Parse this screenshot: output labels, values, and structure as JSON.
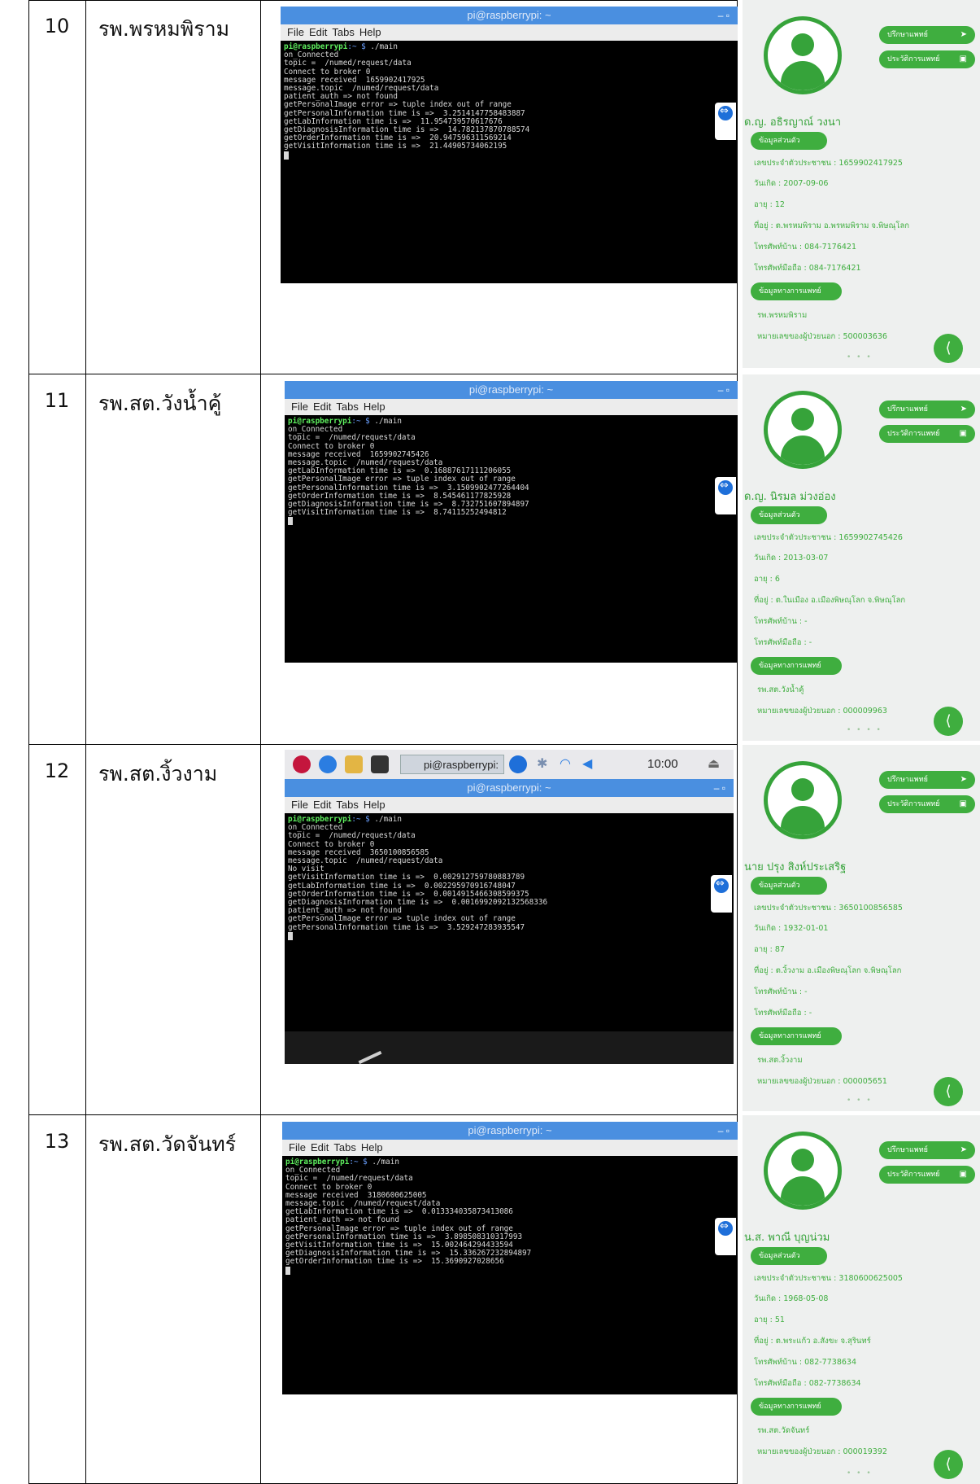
{
  "rows": [
    {
      "number": "10",
      "hospital": "รพ.พรหมพิราม",
      "terminal": {
        "title": "pi@raspberrypi: ~",
        "menu": [
          "File",
          "Edit",
          "Tabs",
          "Help"
        ],
        "prompt_user": "pi@raspberrypi",
        "prompt_path": ":~ $",
        "command": " ./main",
        "lines": [
          "on_Connected",
          "topic =  /numed/request/data",
          "Connect to broker 0",
          "message received  1659902417925",
          "message.topic  /numed/request/data",
          "patient_auth => not found",
          "getPersonalImage error => tuple index out of range",
          "getPersonalInformation time is =>  3.2514147758483887",
          "getLabInformation time is =>  11.954739570617676",
          "getDiagnosisInformation time is =>  14.782137870788574",
          "getOrderInformation time is =>  20.947596311569214",
          "getVisitInformation time is =>  21.44905734062195"
        ]
      },
      "profile": {
        "btn_consult": "ปรึกษาแพทย์",
        "btn_history": "ประวัติการแพทย์",
        "name": "ด.ญ. อธิรญาณ์ วงนา",
        "sec_personal": "ข้อมูลส่วนตัว",
        "id_line": "เลขประจำตัวประชาชน : 1659902417925",
        "birth_line": "วันเกิด : 2007-09-06",
        "age_line": "อายุ : 12",
        "addr_line": "ที่อยู่ : ต.พรหมพิราม อ.พรหมพิราม จ.พิษณุโลก",
        "phone_line": "โทรศัพท์บ้าน : 084-7176421",
        "mobile_line": "โทรศัพท์มือถือ : 084-7176421",
        "sec_medical": "ข้อมูลทางการแพทย์",
        "hospital_line": "รพ.พรหมพิราม",
        "hn_line": "หมายเลขของผู้ป่วยนอก : 500003636",
        "pager": "• • •"
      }
    },
    {
      "number": "11",
      "hospital": "รพ.สต.วังน้ำคู้",
      "terminal": {
        "title": "pi@raspberrypi: ~",
        "menu": [
          "File",
          "Edit",
          "Tabs",
          "Help"
        ],
        "prompt_user": "pi@raspberrypi",
        "prompt_path": ":~ $",
        "command": " ./main",
        "lines": [
          "on_Connected",
          "topic =  /numed/request/data",
          "Connect to broker 0",
          "message received  1659902745426",
          "message.topic  /numed/request/data",
          "getLabInformation time is =>  0.16887617111206055",
          "getPersonalImage error => tuple index out of range",
          "getPersonalInformation time is =>  3.1509902477264404",
          "getOrderInformation time is =>  8.545461177825928",
          "getDiagnosisInformation time is =>  8.732751607894897",
          "getVisitInformation time is =>  8.74115252494812"
        ]
      },
      "profile": {
        "btn_consult": "ปรึกษาแพทย์",
        "btn_history": "ประวัติการแพทย์",
        "name": "ด.ญ. นิรมล ม่วงอ่อง",
        "sec_personal": "ข้อมูลส่วนตัว",
        "id_line": "เลขประจำตัวประชาชน : 1659902745426",
        "birth_line": "วันเกิด : 2013-03-07",
        "age_line": "อายุ : 6",
        "addr_line": "ที่อยู่ : ต.ในเมือง อ.เมืองพิษณุโลก จ.พิษณุโลก",
        "phone_line": "โทรศัพท์บ้าน : -",
        "mobile_line": "โทรศัพท์มือถือ : -",
        "sec_medical": "ข้อมูลทางการแพทย์",
        "hospital_line": "รพ.สต.วังน้ำคู้",
        "hn_line": "หมายเลขของผู้ป่วยนอก : 000009963",
        "pager": "• • • •"
      }
    },
    {
      "number": "12",
      "hospital": "รพ.สต.งิ้วงาม",
      "taskbar": {
        "task": "pi@raspberrypi: ~",
        "clock": "10:00"
      },
      "terminal": {
        "title": "pi@raspberrypi: ~",
        "menu": [
          "File",
          "Edit",
          "Tabs",
          "Help"
        ],
        "prompt_user": "pi@raspberrypi",
        "prompt_path": ":~ $",
        "command": " ./main",
        "lines": [
          "on_Connected",
          "topic =  /numed/request/data",
          "Connect to broker 0",
          "message received  3650100856585",
          "message.topic  /numed/request/data",
          "No visit",
          "getVisitInformation time is =>  0.002912759780883789",
          "getLabInformation time is =>  0.002295970916748047",
          "getOrderInformation time is =>  0.0014915466308599375",
          "getDiagnosisInformation time is =>  0.0016992092132568336",
          "patient_auth => not found",
          "getPersonalImage error => tuple index out of range",
          "getPersonalInformation time is =>  3.529247283935547"
        ]
      },
      "profile": {
        "btn_consult": "ปรึกษาแพทย์",
        "btn_history": "ประวัติการแพทย์",
        "name": "นาย ปรุง สิงห์ประเสริฐ",
        "sec_personal": "ข้อมูลส่วนตัว",
        "id_line": "เลขประจำตัวประชาชน : 3650100856585",
        "birth_line": "วันเกิด : 1932-01-01",
        "age_line": "อายุ : 87",
        "addr_line": "ที่อยู่ : ต.งิ้วงาม อ.เมืองพิษณุโลก จ.พิษณุโลก",
        "phone_line": "โทรศัพท์บ้าน : -",
        "mobile_line": "โทรศัพท์มือถือ : -",
        "sec_medical": "ข้อมูลทางการแพทย์",
        "hospital_line": "รพ.สต.งิ้วงาม",
        "hn_line": "หมายเลขของผู้ป่วยนอก : 000005651",
        "pager": "• • •"
      }
    },
    {
      "number": "13",
      "hospital": "รพ.สต.วัดจันทร์",
      "terminal": {
        "title": "pi@raspberrypi: ~",
        "menu": [
          "File",
          "Edit",
          "Tabs",
          "Help"
        ],
        "prompt_user": "pi@raspberrypi",
        "prompt_path": ":~ $",
        "command": " ./main",
        "lines": [
          "on_Connected",
          "topic =  /numed/request/data",
          "Connect to broker 0",
          "message received  3180600625005",
          "message.topic  /numed/request/data",
          "getLabInformation time is =>  0.013334035873413086",
          "patient_auth => not found",
          "getPersonalImage error => tuple index out of range",
          "getPersonalInformation time is =>  3.898508310317993",
          "getVisitInformation time is =>  15.002464294433594",
          "getDiagnosisInformation time is =>  15.336267232894897",
          "getOrderInformation time is =>  15.3690927028656"
        ]
      },
      "profile": {
        "btn_consult": "ปรึกษาแพทย์",
        "btn_history": "ประวัติการแพทย์",
        "name": "น.ส. พาณี บุญน่วม",
        "sec_personal": "ข้อมูลส่วนตัว",
        "id_line": "เลขประจำตัวประชาชน : 3180600625005",
        "birth_line": "วันเกิด : 1968-05-08",
        "age_line": "อายุ : 51",
        "addr_line": "ที่อยู่ : ต.พระแก้ว อ.สังขะ จ.สุรินทร์",
        "phone_line": "โทรศัพท์บ้าน : 082-7738634",
        "mobile_line": "โทรศัพท์มือถือ : 082-7738634",
        "sec_medical": "ข้อมูลทางการแพทย์",
        "hospital_line": "รพ.สต.วัดจันทร์",
        "hn_line": "หมายเลขของผู้ป่วยนอก : 000019392",
        "pager": "• • •"
      }
    }
  ],
  "icons": {
    "send": "send-icon",
    "card": "id-card-icon",
    "share": "share-icon",
    "teamviewer": "teamviewer-icon"
  },
  "colors": {
    "accent_green": "#3fae3f",
    "titlebar_blue": "#4a8fe0",
    "terminal_bg": "#000000"
  }
}
